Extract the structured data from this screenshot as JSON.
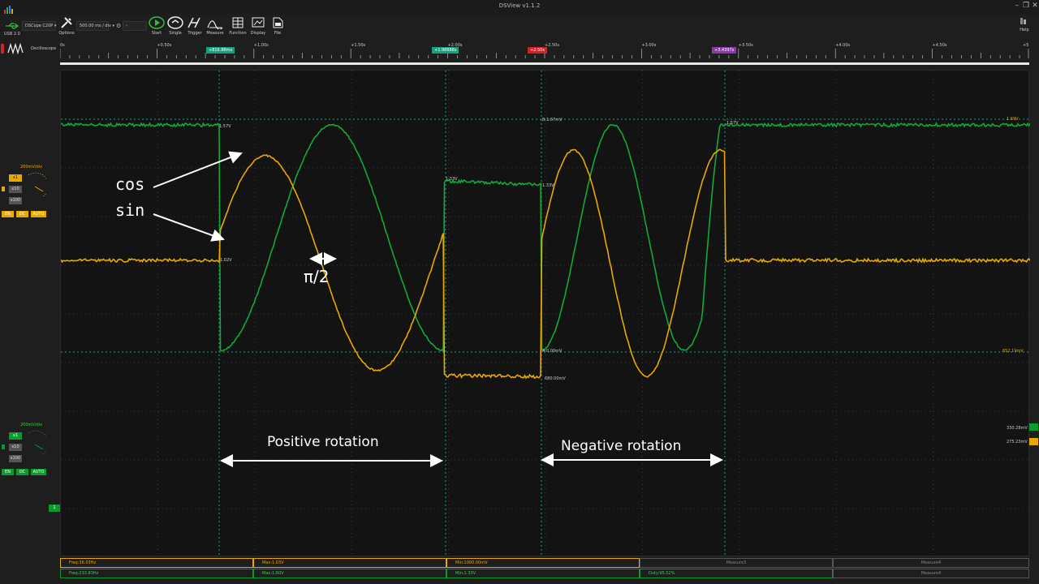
{
  "window": {
    "title": "DSView v1.1.2"
  },
  "device": {
    "usb": "USB 2.0",
    "name": "DSCope C20P",
    "mode": "Oscilloscope",
    "timebase": "500.00 ms / div"
  },
  "toolbar": {
    "options": "Options",
    "start": "Start",
    "single": "Single",
    "trigger": "Trigger",
    "measure": "Measure",
    "function": "Function",
    "display": "Display",
    "file": "File",
    "help": "Help"
  },
  "ruler": {
    "ticks": [
      "0s",
      "+0.50s",
      "+1.00s",
      "+1.50s",
      "+2.00s",
      "+2.50s",
      "+3.00s",
      "+3.50s",
      "+4.00s",
      "+4.50s",
      "+5"
    ],
    "cursors": [
      {
        "label": "+816.88ms",
        "color": "#1aa080"
      },
      {
        "label": "+1.98888s",
        "color": "#1aa080"
      },
      {
        "label": "+2.50s",
        "color": "#d0202a"
      },
      {
        "label": "+3.4397s",
        "color": "#8a3aa8"
      }
    ]
  },
  "channel0": {
    "vdiv": "200mV/div",
    "x1": "x1",
    "x10": "x10",
    "x100": "x100",
    "en": "EN",
    "dc": "DC",
    "auto": "AUTO",
    "color": "#e8a800"
  },
  "channel1": {
    "vdiv": "200mV/div",
    "x1": "x1",
    "x10": "x10",
    "x100": "x100",
    "en": "EN",
    "dc": "DC",
    "auto": "AUTO",
    "color": "#0a9a30",
    "index": "1"
  },
  "scope": {
    "readouts": {
      "g_high": "1.57V",
      "g_mid": "1.33V",
      "g_low": "652.19mV",
      "y_low": "1.02V",
      "right_g": "1.69V",
      "right_low": "652.19mV",
      "right_a": "330.28mV",
      "right_b": "275.23mV",
      "cursor_top": "B:1.67mV",
      "cursor_bot": "A:0.00mV",
      "plateau": "1.33V",
      "plateau_low": "680.00mV"
    },
    "annotations": {
      "cos": "cos",
      "sin": "sin",
      "phase": "π/2",
      "positive": "Positive rotation",
      "negative": "Negative rotation"
    }
  },
  "measures": {
    "row1": [
      "Freq:36.03Hz",
      "Max:1.03V",
      "Min:1000.00mV",
      "Measure3",
      "Measure4"
    ],
    "row2": [
      "Freq:233.83Hz",
      "Max:1.60V",
      "Min:1.33V",
      "Duty:95.52%",
      "Measure4"
    ]
  }
}
